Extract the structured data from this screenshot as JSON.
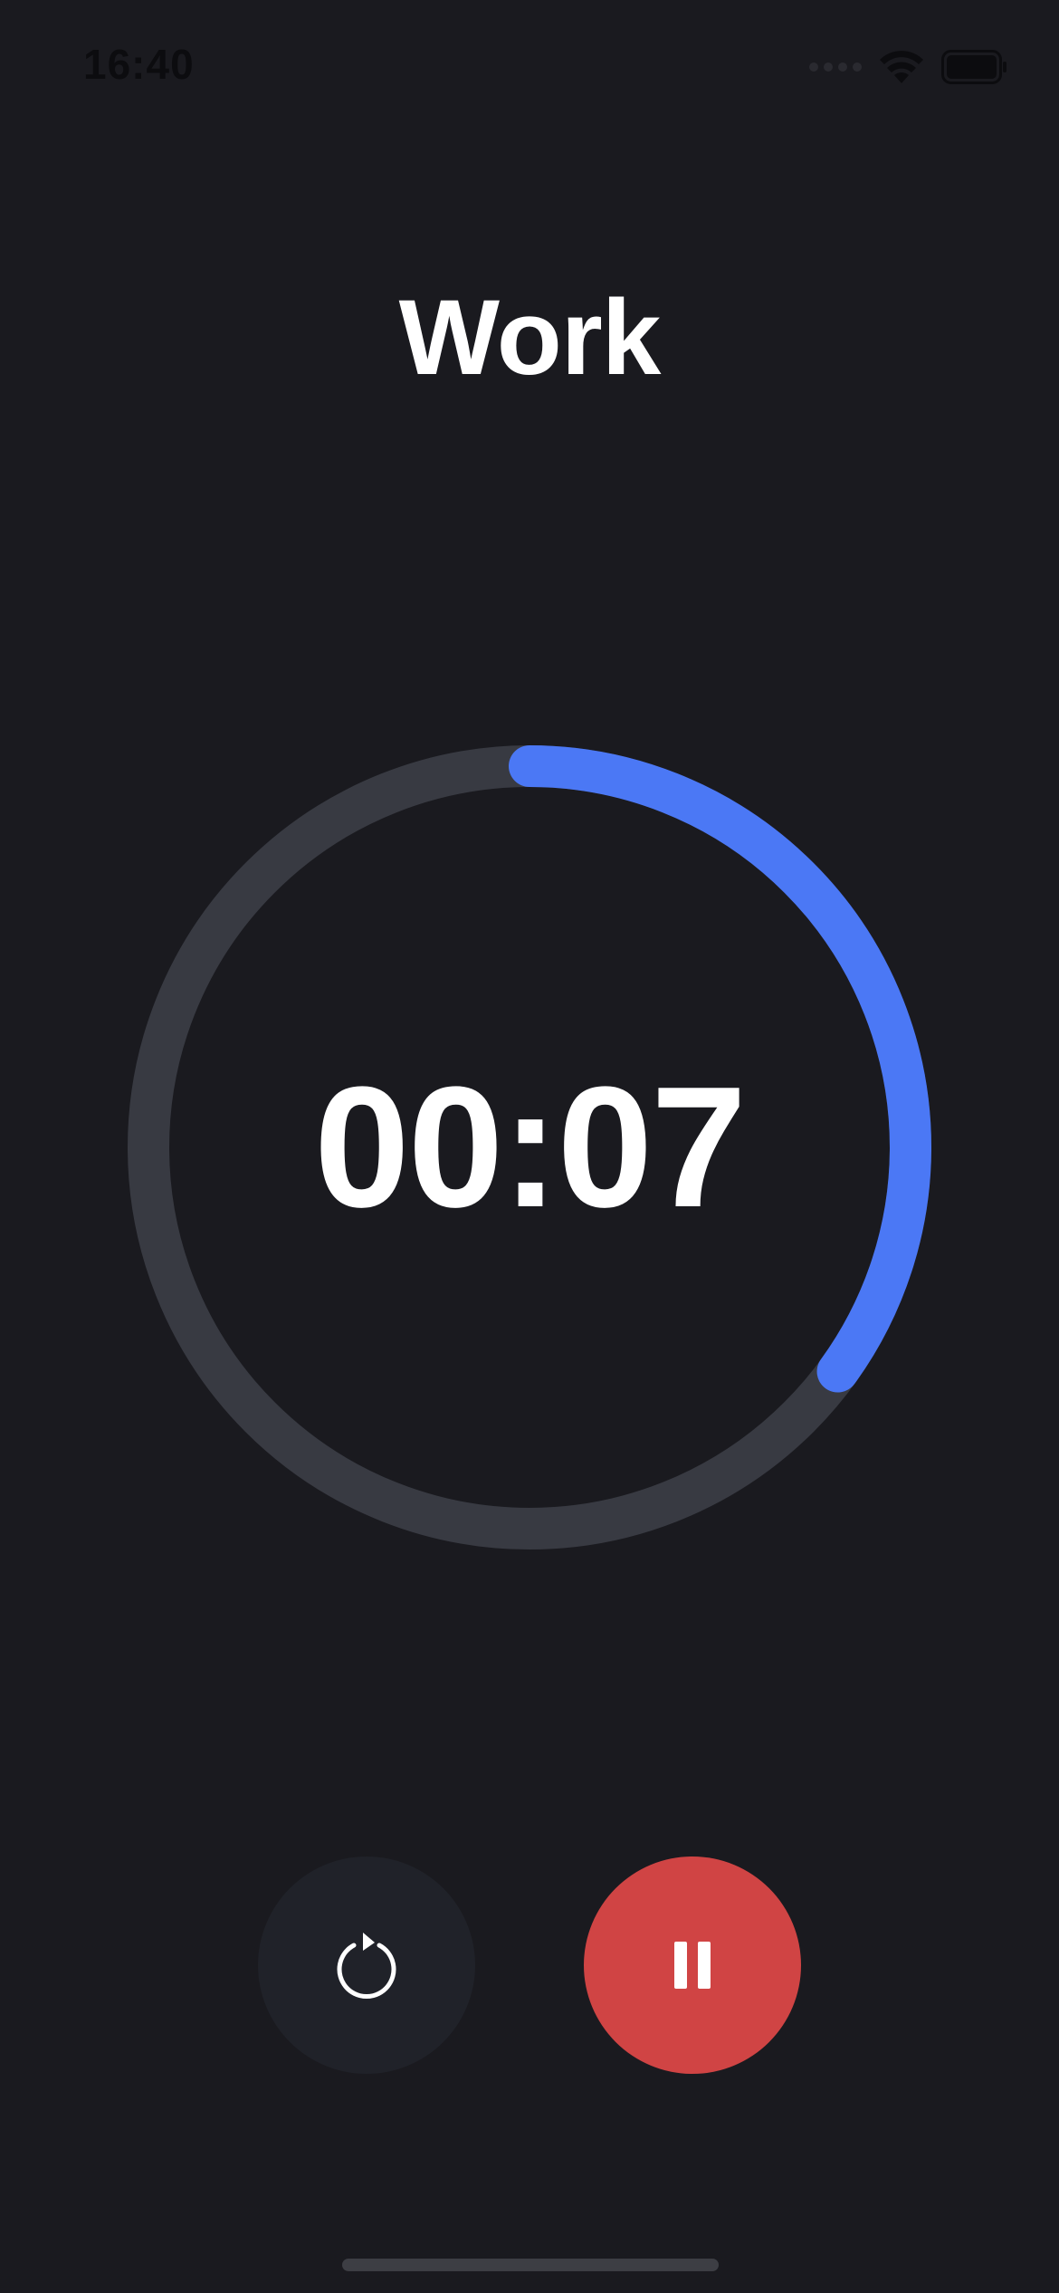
{
  "status_bar": {
    "time": "16:40",
    "icons": [
      "cellular-signal-icon",
      "wifi-icon",
      "battery-icon"
    ]
  },
  "timer": {
    "mode_title": "Work",
    "time_display": "00:07",
    "progress_fraction": 0.35,
    "colors": {
      "track": "#383a42",
      "progress": "#4b78f5",
      "background": "#1a1a1f"
    }
  },
  "controls": {
    "reset": {
      "icon": "reset-icon",
      "color": "#202229"
    },
    "pause": {
      "icon": "pause-icon",
      "color": "#d04444"
    }
  }
}
